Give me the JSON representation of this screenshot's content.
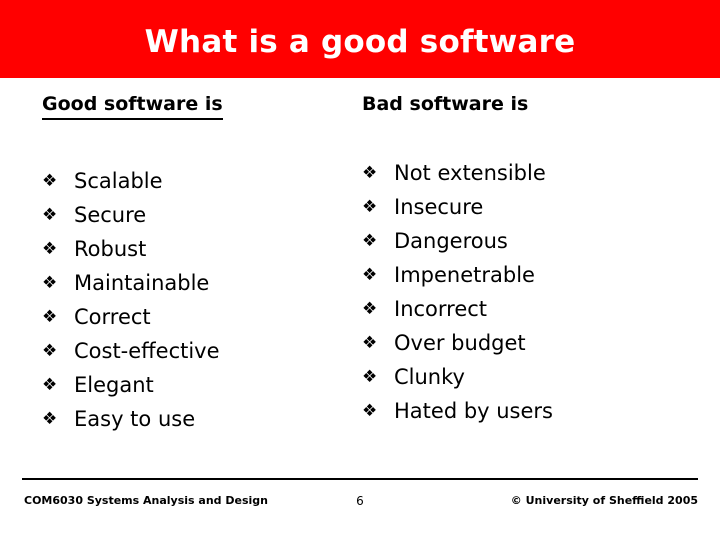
{
  "slide": {
    "title": "What is a good software",
    "title_band_color": "#ff0000",
    "title_text_color": "#ffffff",
    "bullet_marker": "❖",
    "left_column": {
      "heading": "Good software is",
      "items": [
        "Scalable",
        "Secure",
        "Robust",
        "Maintainable",
        "Correct",
        "Cost-effective",
        "Elegant",
        "Easy to use"
      ]
    },
    "right_column": {
      "heading": "Bad software is",
      "items": [
        "Not extensible",
        "Insecure",
        "Dangerous",
        "Impenetrable",
        "Incorrect",
        "Over budget",
        "Clunky",
        "Hated by users"
      ]
    },
    "footer": {
      "course": "COM6030 Systems Analysis and Design",
      "page_number": "6",
      "copyright": "© University of Sheffield 2005"
    }
  }
}
